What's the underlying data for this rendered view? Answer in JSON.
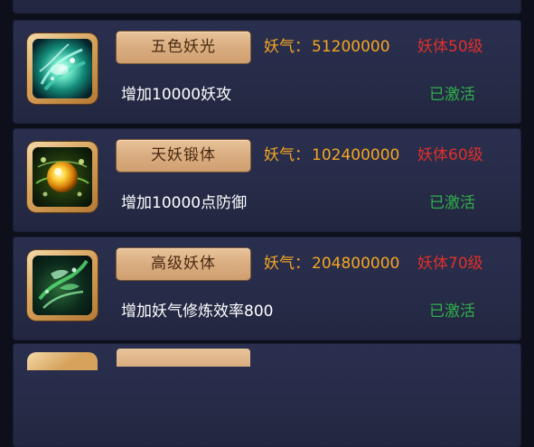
{
  "items": [
    {
      "name": "五色妖光",
      "qi_label": "妖气：",
      "qi_value": "51200000",
      "level": "妖体50级",
      "desc": "增加10000妖攻",
      "status": "已激活",
      "icon": "wind-orb-icon"
    },
    {
      "name": "天妖锻体",
      "qi_label": "妖气：",
      "qi_value": "102400000",
      "level": "妖体60级",
      "desc": "增加10000点防御",
      "status": "已激活",
      "icon": "golden-orb-icon"
    },
    {
      "name": "高级妖体",
      "qi_label": "妖气：",
      "qi_value": "204800000",
      "level": "妖体70级",
      "desc": "增加妖气修炼效率800",
      "status": "已激活",
      "icon": "spirit-wind-icon"
    }
  ],
  "colors": {
    "qi": "#f5a623",
    "level": "#e0302a",
    "status": "#2fb04a",
    "card_bg": "#262b47",
    "plate": "#d9ad80"
  }
}
